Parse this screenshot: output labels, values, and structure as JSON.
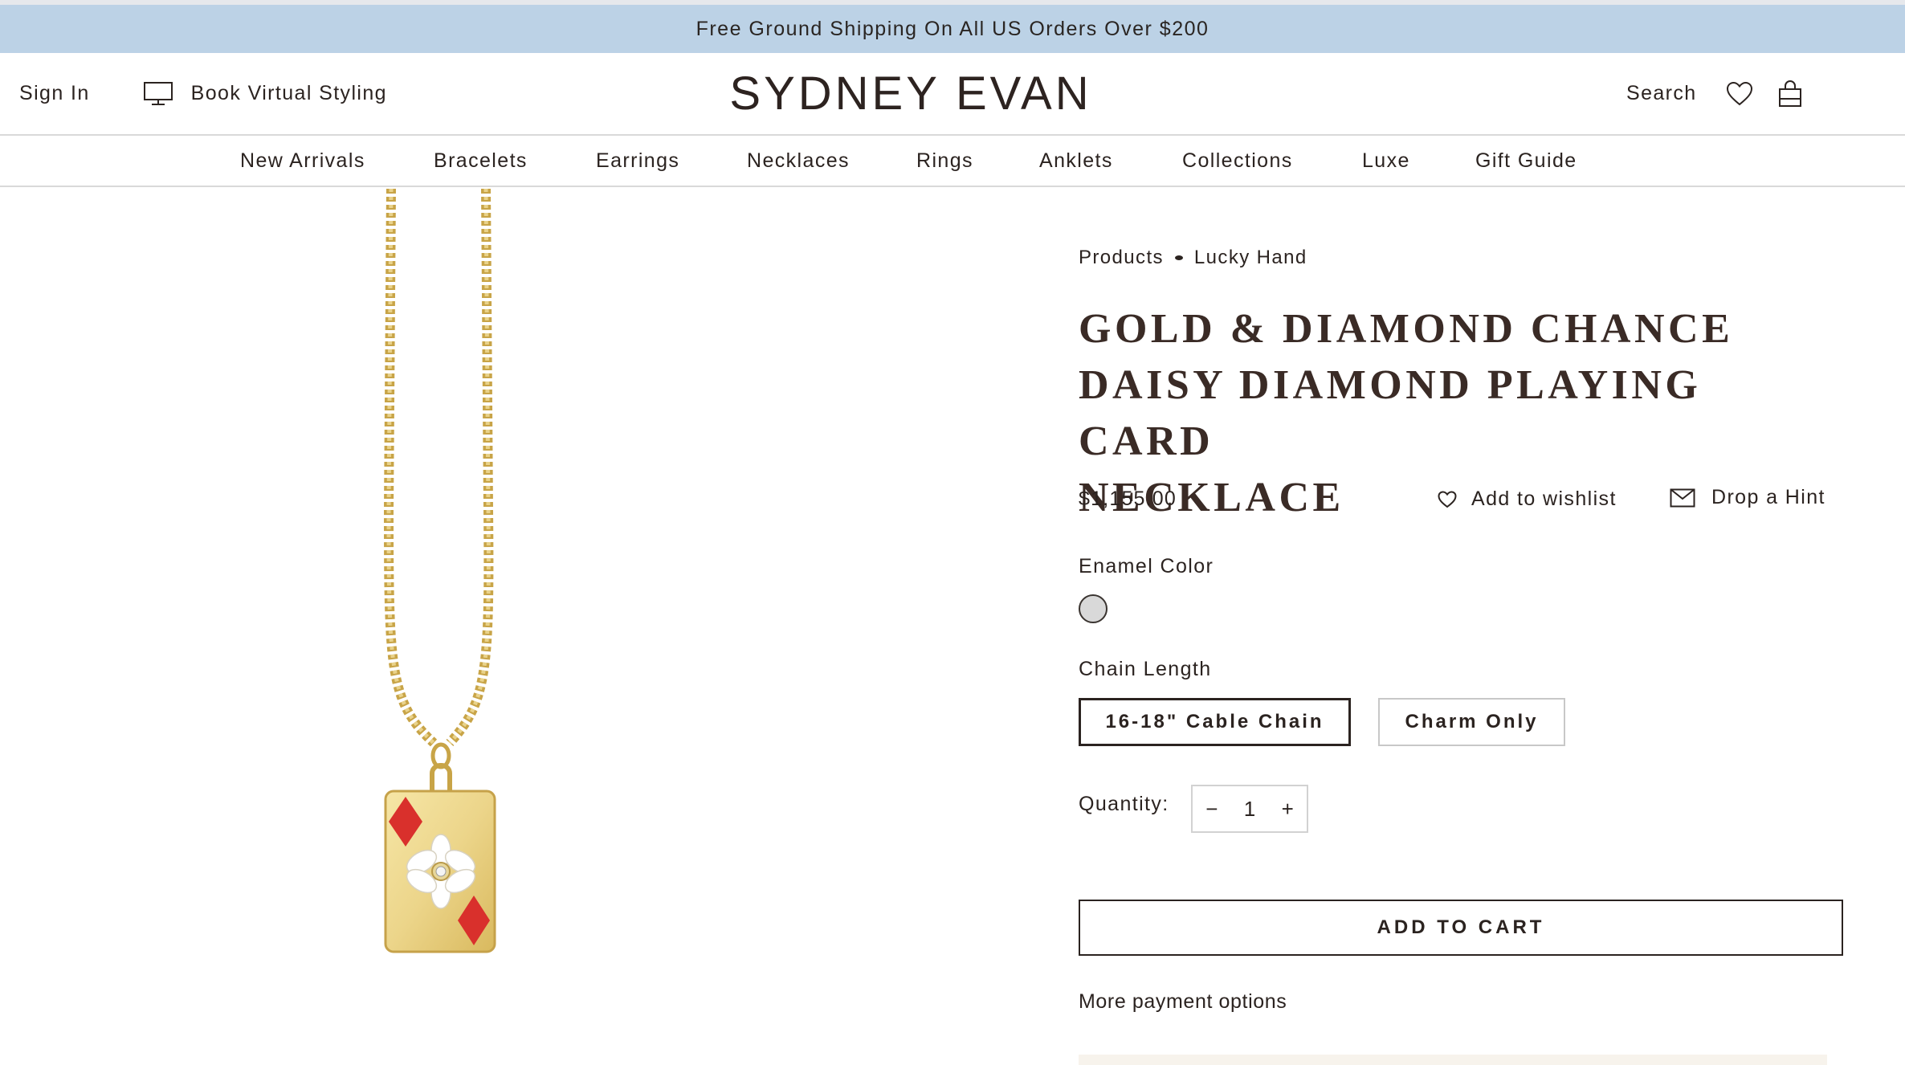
{
  "promo": {
    "text": "Free Ground Shipping On All US Orders Over $200"
  },
  "header": {
    "sign_in": "Sign In",
    "book_styling": "Book Virtual Styling",
    "logo": "SYDNEY EVAN",
    "search": "Search",
    "icons": [
      "monitor-icon",
      "heart-icon",
      "bag-icon"
    ]
  },
  "nav": {
    "items": [
      "New Arrivals",
      "Bracelets",
      "Earrings",
      "Necklaces",
      "Rings",
      "Anklets",
      "Collections",
      "Luxe",
      "Gift Guide"
    ]
  },
  "product": {
    "breadcrumb": [
      "Products",
      "Lucky Hand"
    ],
    "title_lines": [
      "GOLD & DIAMOND CHANCE",
      "DAISY DIAMOND PLAYING CARD",
      "NECKLACE"
    ],
    "price": "$1,155.00",
    "wishlist_label": "Add to wishlist",
    "hint_label": "Drop a Hint",
    "enamel_color_label": "Enamel Color",
    "enamel_swatch_color": "#d9d9d9",
    "chain_length_label": "Chain Length",
    "chain_options": [
      "16-18\" Cable Chain",
      "Charm Only"
    ],
    "chain_selected": "16-18\" Cable Chain",
    "quantity_label": "Quantity:",
    "quantity_minus": "−",
    "quantity_value": "1",
    "quantity_plus": "+",
    "add_to_cart": "ADD TO CART",
    "more_payment": "More payment options"
  },
  "colors": {
    "promo_bg": "#bcd2e6",
    "text": "#2b2320",
    "gold": "#e8cf7a",
    "enamel_red": "#d9302c"
  }
}
